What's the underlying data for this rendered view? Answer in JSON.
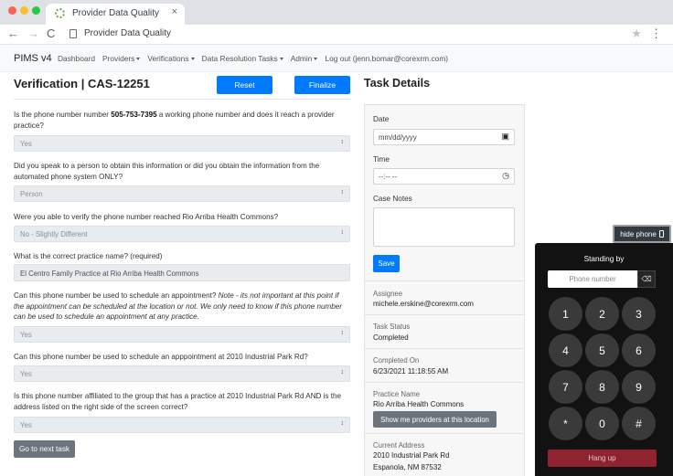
{
  "browser": {
    "tab_title": "Provider Data Quality",
    "tab_close": "×",
    "url": "Provider Data Quality",
    "icons": [
      "favicon-icon",
      "back-arrow-icon",
      "forward-arrow-icon",
      "reload-icon",
      "page-icon",
      "star-icon",
      "kebab-menu-icon"
    ],
    "back": "←",
    "forward": "→",
    "reload": "C",
    "star": "★",
    "kebab": "⋮"
  },
  "navbar": {
    "brand": "PIMS v4",
    "links": [
      {
        "label": "Dashboard",
        "dropdown": false
      },
      {
        "label": "Providers",
        "dropdown": true
      },
      {
        "label": "Verifications",
        "dropdown": true
      },
      {
        "label": "Data Resolution Tasks",
        "dropdown": true
      },
      {
        "label": "Admin",
        "dropdown": true
      },
      {
        "label": "Log out (jenn.bomar@corexrm.com)",
        "dropdown": false
      }
    ]
  },
  "verification": {
    "title": "Verification | CAS-12251",
    "reset_label": "Reset",
    "finalize_label": "Finalize",
    "questions": [
      {
        "pre": "Is the phone number number ",
        "bold": "505-753-7395",
        "post": " a working phone number and does it reach a provider practice?",
        "answer": "Yes"
      },
      {
        "text": "Did you speak to a person to obtain this information or did you obtain the information from the automated phone system ONLY?",
        "answer": "Person"
      },
      {
        "text": "Were you able to verify the phone number reached Rio Arriba Health Commons?",
        "answer": "No - Slightly Different"
      },
      {
        "text": "What is the correct practice name? (required)",
        "answer": "El Centro Family Practice at Rio Arriba Health Commons"
      },
      {
        "pre": "Can this phone number be used to schedule an appointment? ",
        "italic": "Note - its not important at this point if the appointment can be scheduled at the location or not. We only need to know if this phone number can be used to schedule an appointment at any practice.",
        "answer": "Yes"
      },
      {
        "text": "Can this phone number be used to schedule an apppointment at 2010 Industrial Park Rd?",
        "answer": "Yes"
      },
      {
        "text": "Is this phone number affiliated to the group that has a practice at 2010 Industrial Park Rd AND is the address listed on the right side of the screen correct?",
        "answer": "Yes"
      }
    ],
    "next_task_label": "Go to next task"
  },
  "task_details": {
    "title": "Task Details",
    "date_label": "Date",
    "date_value": "mm/dd/yyyy",
    "time_label": "Time",
    "time_value": "--:-- --",
    "notes_label": "Case Notes",
    "save_label": "Save",
    "assignee_label": "Assignee",
    "assignee_value": "michele.erskine@corexrm.com",
    "status_label": "Task Status",
    "status_value": "Completed",
    "completed_label": "Completed On",
    "completed_value": "6/23/2021 11:18:55 AM",
    "practice_label": "Practice Name",
    "practice_value": "Rio Arriba Health Commons",
    "show_providers_label": "Show me providers at this location",
    "address_label": "Current Address",
    "address_line1": "2010 Industrial Park Rd",
    "address_line2": "Espanola, NM 87532"
  },
  "dialer": {
    "hide_label": "hide phone",
    "status": "Standing by",
    "phone_placeholder": "Phone number",
    "backspace": "⌫",
    "keys": [
      "1",
      "2",
      "3",
      "4",
      "5",
      "6",
      "7",
      "8",
      "9",
      "*",
      "0",
      "#"
    ],
    "hangup_label": "Hang up"
  }
}
